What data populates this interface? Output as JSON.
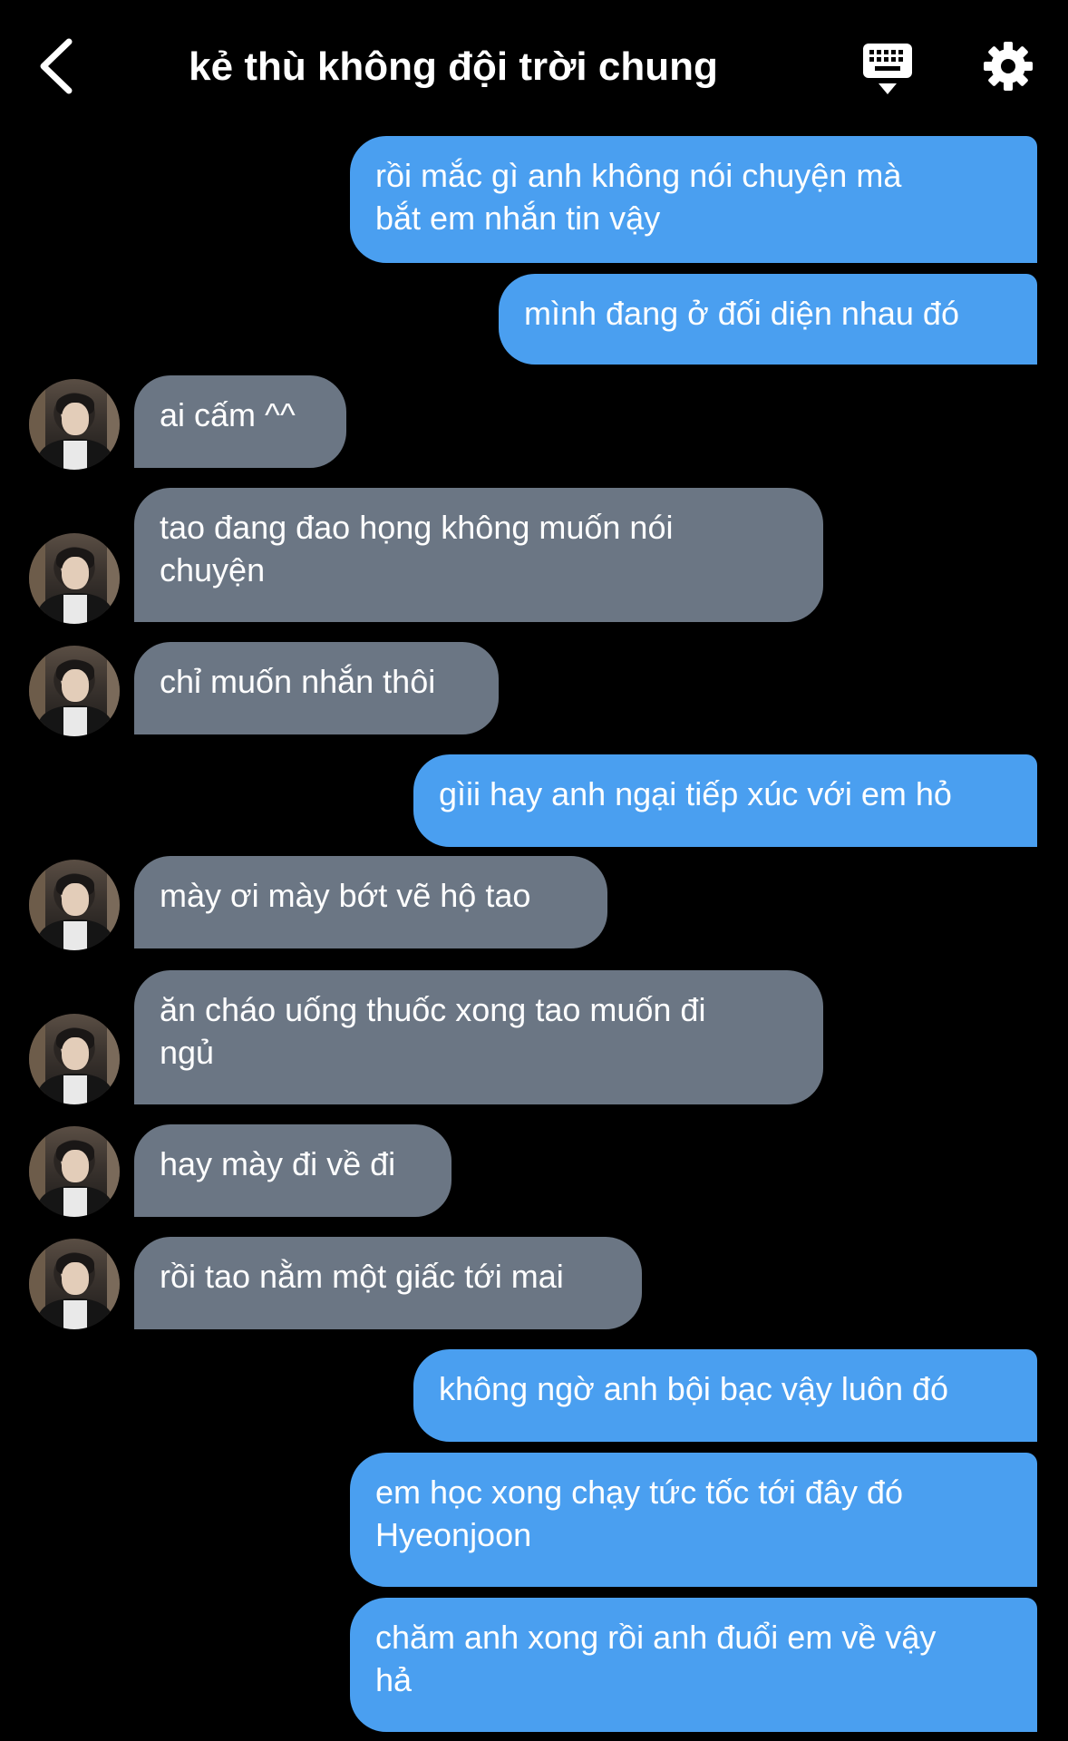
{
  "header": {
    "title": "kẻ thù không đội trời chung",
    "back_icon": "chevron-left-icon",
    "keyboard_icon": "keyboard-icon",
    "settings_icon": "gear-icon"
  },
  "colors": {
    "outgoing": "#4a9ff0",
    "incoming": "#6b7684",
    "background": "#000000"
  },
  "messages": [
    {
      "side": "out",
      "text": "rồi mắc gì anh không nói chuyện mà\nbắt em nhắn tin vậy"
    },
    {
      "side": "out",
      "text": "mình đang ở đối diện nhau đó"
    },
    {
      "side": "in",
      "text": "ai cấm ^^"
    },
    {
      "side": "in",
      "text": "tao đang đao họng không muốn nói\nchuyện"
    },
    {
      "side": "in",
      "text": "chỉ muốn nhắn thôi"
    },
    {
      "side": "out",
      "text": "gìii hay anh ngại tiếp xúc với em hỏ"
    },
    {
      "side": "in",
      "text": "mày ơi mày bớt vẽ hộ tao"
    },
    {
      "side": "in",
      "text": "ăn cháo uống thuốc xong tao muốn đi\nngủ"
    },
    {
      "side": "in",
      "text": "hay mày đi về đi"
    },
    {
      "side": "in",
      "text": "rồi tao nằm một giấc tới mai"
    },
    {
      "side": "out",
      "text": "không ngờ anh bội bạc vậy luôn đó"
    },
    {
      "side": "out",
      "text": "em học xong chạy tức tốc tới đây đó\nHyeonjoon"
    },
    {
      "side": "out",
      "text": "chăm anh xong rồi anh đuổi em về vậy\nhả"
    }
  ]
}
